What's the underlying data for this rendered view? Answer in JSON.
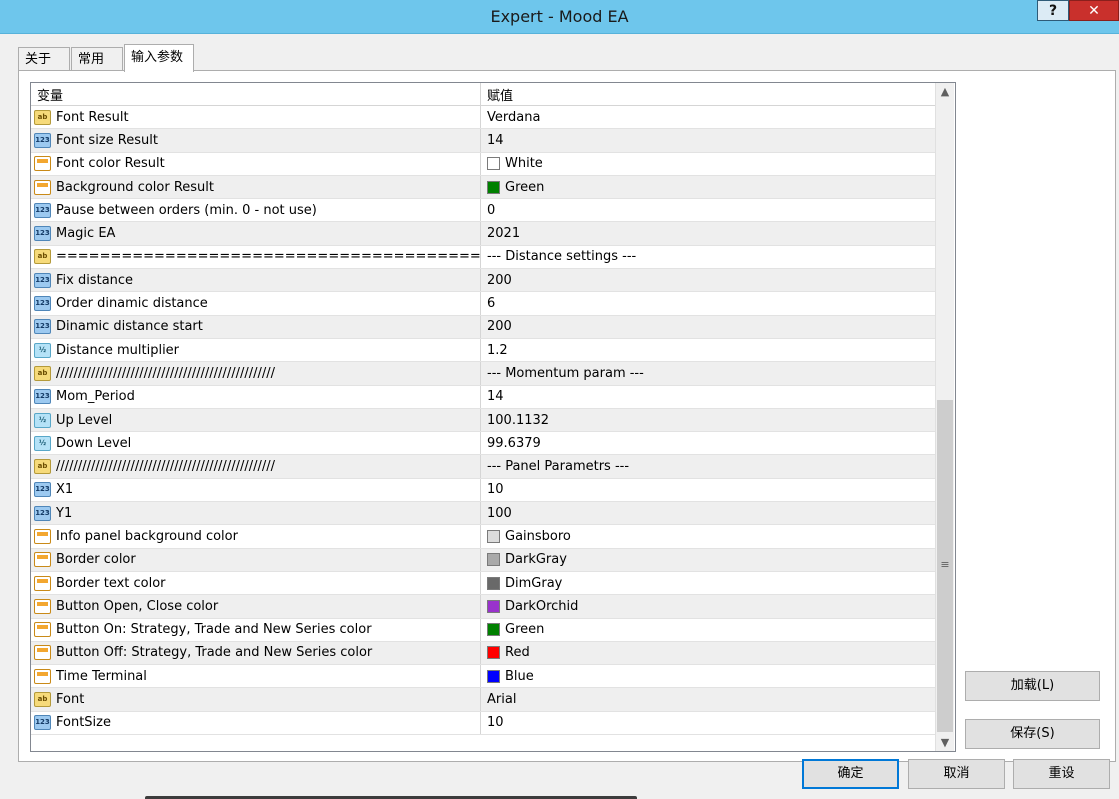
{
  "window": {
    "title": "Expert - Mood EA",
    "help_label": "?",
    "close_label": "✕"
  },
  "tabs": [
    {
      "label": "关于"
    },
    {
      "label": "常用"
    },
    {
      "label": "输入参数"
    }
  ],
  "table": {
    "headers": {
      "name": "变量",
      "value": "赋值"
    },
    "rows": [
      {
        "icon": "string",
        "name": "Font Result",
        "value": "Verdana"
      },
      {
        "icon": "int",
        "name": "Font size Result",
        "value": "14"
      },
      {
        "icon": "color",
        "name": "Font color Result",
        "value": "White",
        "color": "#ffffff"
      },
      {
        "icon": "color",
        "name": "Background color Result",
        "value": "Green",
        "color": "#008000"
      },
      {
        "icon": "int",
        "name": "Pause between orders (min. 0 - not use)",
        "value": "0"
      },
      {
        "icon": "int",
        "name": "Magic EA",
        "value": "2021"
      },
      {
        "icon": "string",
        "name": "=======================================",
        "value": "--- Distance settings ---"
      },
      {
        "icon": "int",
        "name": "Fix distance",
        "value": "200"
      },
      {
        "icon": "int",
        "name": "Order dinamic distance",
        "value": "6"
      },
      {
        "icon": "int",
        "name": "Dinamic distance start",
        "value": "200"
      },
      {
        "icon": "double",
        "name": "Distance multiplier",
        "value": "1.2"
      },
      {
        "icon": "string",
        "name": "//////////////////////////////////////////////////",
        "value": "--- Momentum param ---"
      },
      {
        "icon": "int",
        "name": "Mom_Period",
        "value": "14"
      },
      {
        "icon": "double",
        "name": "Up Level",
        "value": "100.1132"
      },
      {
        "icon": "double",
        "name": "Down Level",
        "value": "99.6379"
      },
      {
        "icon": "string",
        "name": "//////////////////////////////////////////////////",
        "value": "--- Panel Parametrs ---"
      },
      {
        "icon": "int",
        "name": "X1",
        "value": "10"
      },
      {
        "icon": "int",
        "name": "Y1",
        "value": "100"
      },
      {
        "icon": "color",
        "name": "Info panel background color",
        "value": "Gainsboro",
        "color": "#dcdcdc"
      },
      {
        "icon": "color",
        "name": "Border color",
        "value": "DarkGray",
        "color": "#a9a9a9"
      },
      {
        "icon": "color",
        "name": "Border text color",
        "value": "DimGray",
        "color": "#696969"
      },
      {
        "icon": "color",
        "name": "Button Open, Close color",
        "value": "DarkOrchid",
        "color": "#9932cc"
      },
      {
        "icon": "color",
        "name": "Button On: Strategy, Trade and New Series color",
        "value": "Green",
        "color": "#008000"
      },
      {
        "icon": "color",
        "name": "Button Off: Strategy, Trade and New Series color",
        "value": "Red",
        "color": "#ff0000"
      },
      {
        "icon": "color",
        "name": "Time Terminal",
        "value": "Blue",
        "color": "#0000ff"
      },
      {
        "icon": "string",
        "name": "Font",
        "value": "Arial"
      },
      {
        "icon": "int",
        "name": "FontSize",
        "value": "10"
      }
    ]
  },
  "icon_glyphs": {
    "string": "ab",
    "int": "123",
    "double": "½",
    "color": ""
  },
  "buttons": {
    "load": "加载(L)",
    "save": "保存(S)",
    "ok": "确定",
    "cancel": "取消",
    "reset": "重设"
  }
}
